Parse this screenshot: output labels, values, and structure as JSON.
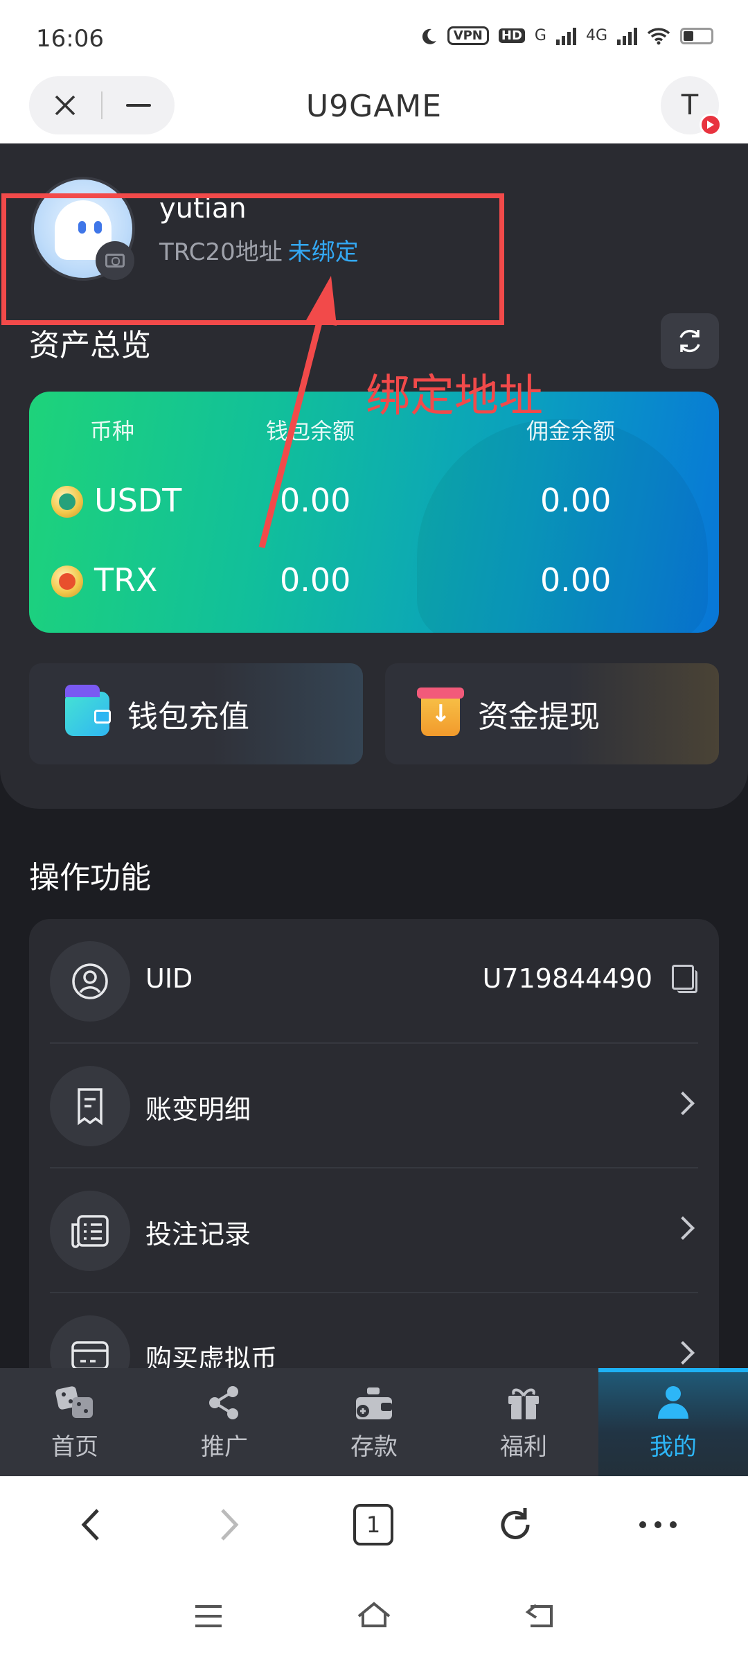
{
  "status_bar": {
    "time": "16:06",
    "vpn": "VPN",
    "hd": "HD",
    "net1": "G",
    "net2": "4G"
  },
  "header": {
    "title": "U9GAME",
    "avatar_letter": "T"
  },
  "profile": {
    "username": "yutian",
    "address_label": "TRC20地址",
    "address_status": "未绑定"
  },
  "annotation": {
    "text": "绑定地址",
    "color": "#f24a4a"
  },
  "assets": {
    "title": "资产总览",
    "columns": [
      "币种",
      "钱包余额",
      "佣金余额"
    ],
    "rows": [
      {
        "coin": "USDT",
        "wallet": "0.00",
        "commission": "0.00"
      },
      {
        "coin": "TRX",
        "wallet": "0.00",
        "commission": "0.00"
      }
    ]
  },
  "actions": {
    "deposit": "钱包充值",
    "withdraw": "资金提现"
  },
  "operations": {
    "title": "操作功能",
    "items": [
      {
        "label": "UID",
        "value": "U719844490",
        "icon": "user-circle-icon"
      },
      {
        "label": "账变明细",
        "icon": "receipt-icon"
      },
      {
        "label": "投注记录",
        "icon": "betting-record-icon"
      },
      {
        "label": "购买虚拟币",
        "icon": "card-icon"
      }
    ]
  },
  "tabs": [
    {
      "label": "首页",
      "icon": "dice-icon"
    },
    {
      "label": "推广",
      "icon": "share-icon"
    },
    {
      "label": "存款",
      "icon": "deposit-icon"
    },
    {
      "label": "福利",
      "icon": "gift-icon"
    },
    {
      "label": "我的",
      "icon": "person-icon",
      "active": true
    }
  ],
  "browser": {
    "tab_count": "1"
  },
  "colors": {
    "accent": "#2db6f7",
    "background": "#1c1d22",
    "card": "#2a2b31"
  }
}
